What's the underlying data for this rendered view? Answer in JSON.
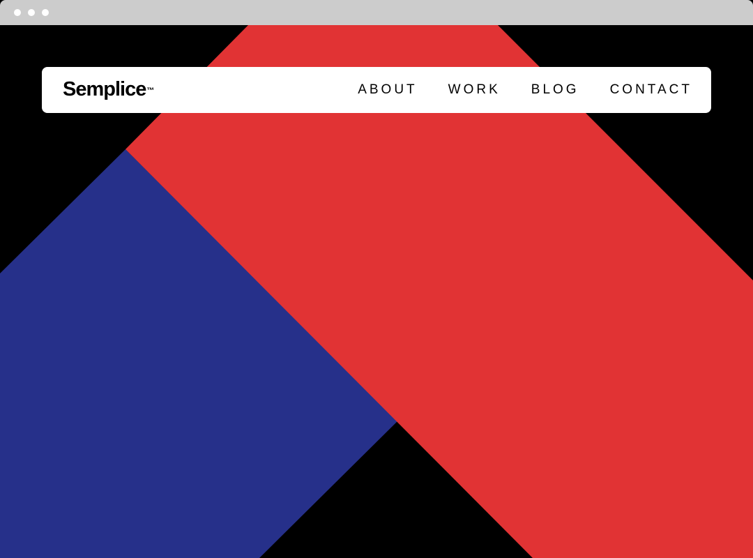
{
  "brand": {
    "name": "Semplice",
    "trademark": "™"
  },
  "nav": {
    "items": [
      {
        "label": "ABOUT"
      },
      {
        "label": "WORK"
      },
      {
        "label": "BLOG"
      },
      {
        "label": "CONTACT"
      }
    ]
  },
  "colors": {
    "background": "#000000",
    "accent_red": "#e13334",
    "accent_blue": "#26308a",
    "titlebar": "#cccccc",
    "navbar_bg": "#ffffff"
  }
}
